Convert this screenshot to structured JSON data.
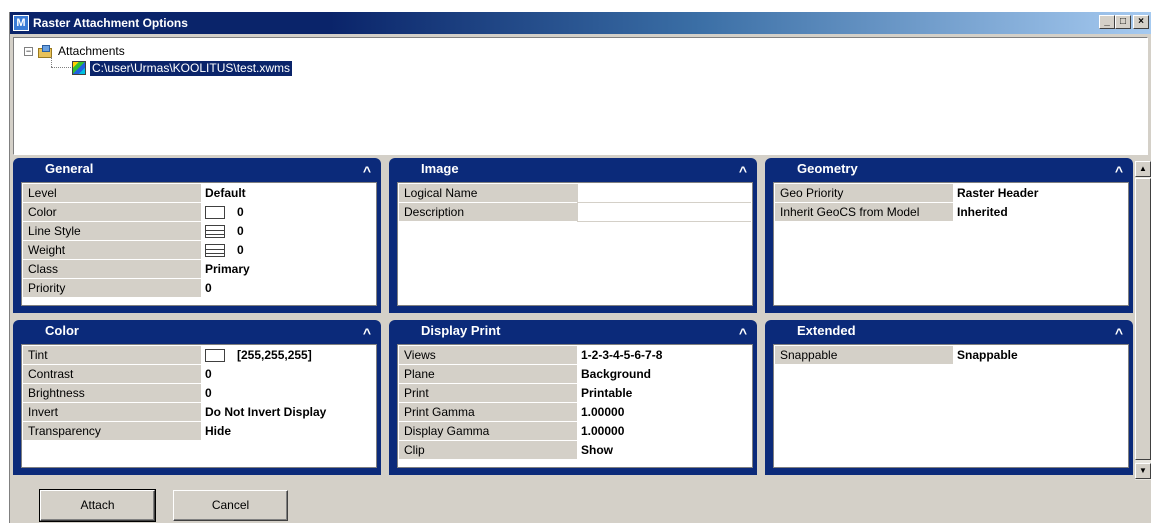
{
  "window": {
    "title": "Raster Attachment Options",
    "buttons": [
      "_",
      "□",
      "×"
    ]
  },
  "tree": {
    "root_label": "Attachments",
    "child_label": "C:\\user\\Urmas\\KOOLITUS\\test.xwms"
  },
  "panels": {
    "general": {
      "title": "General",
      "rows": [
        {
          "key": "Level",
          "value": "Default"
        },
        {
          "key": "Color",
          "value": "0"
        },
        {
          "key": "Line Style",
          "value": "0"
        },
        {
          "key": "Weight",
          "value": "0"
        },
        {
          "key": "Class",
          "value": "Primary"
        },
        {
          "key": "Priority",
          "value": "0"
        }
      ]
    },
    "image": {
      "title": "Image",
      "rows": [
        {
          "key": "Logical Name",
          "value": ""
        },
        {
          "key": "Description",
          "value": ""
        }
      ]
    },
    "geometry": {
      "title": "Geometry",
      "rows": [
        {
          "key": "Geo Priority",
          "value": "Raster Header"
        },
        {
          "key": "Inherit GeoCS from Model",
          "value": "Inherited"
        }
      ]
    },
    "color": {
      "title": "Color",
      "rows": [
        {
          "key": "Tint",
          "value": "[255,255,255]"
        },
        {
          "key": "Contrast",
          "value": "0"
        },
        {
          "key": "Brightness",
          "value": "0"
        },
        {
          "key": "Invert",
          "value": "Do Not Invert Display"
        },
        {
          "key": "Transparency",
          "value": "Hide"
        }
      ]
    },
    "display_print": {
      "title": "Display Print",
      "rows": [
        {
          "key": "Views",
          "value": "1-2-3-4-5-6-7-8"
        },
        {
          "key": "Plane",
          "value": "Background"
        },
        {
          "key": "Print",
          "value": "Printable"
        },
        {
          "key": "Print Gamma",
          "value": "1.00000"
        },
        {
          "key": "Display Gamma",
          "value": "1.00000"
        },
        {
          "key": "Clip",
          "value": "Show"
        }
      ]
    },
    "extended": {
      "title": "Extended",
      "rows": [
        {
          "key": "Snappable",
          "value": "Snappable"
        }
      ]
    }
  },
  "footer": {
    "attach_label": "Attach",
    "cancel_label": "Cancel"
  },
  "colors": {
    "panel_header": "#0b2a7a",
    "title_bar": "#0a246a",
    "selection": "#0a246a",
    "dialog_bg": "#d4d0c8"
  }
}
